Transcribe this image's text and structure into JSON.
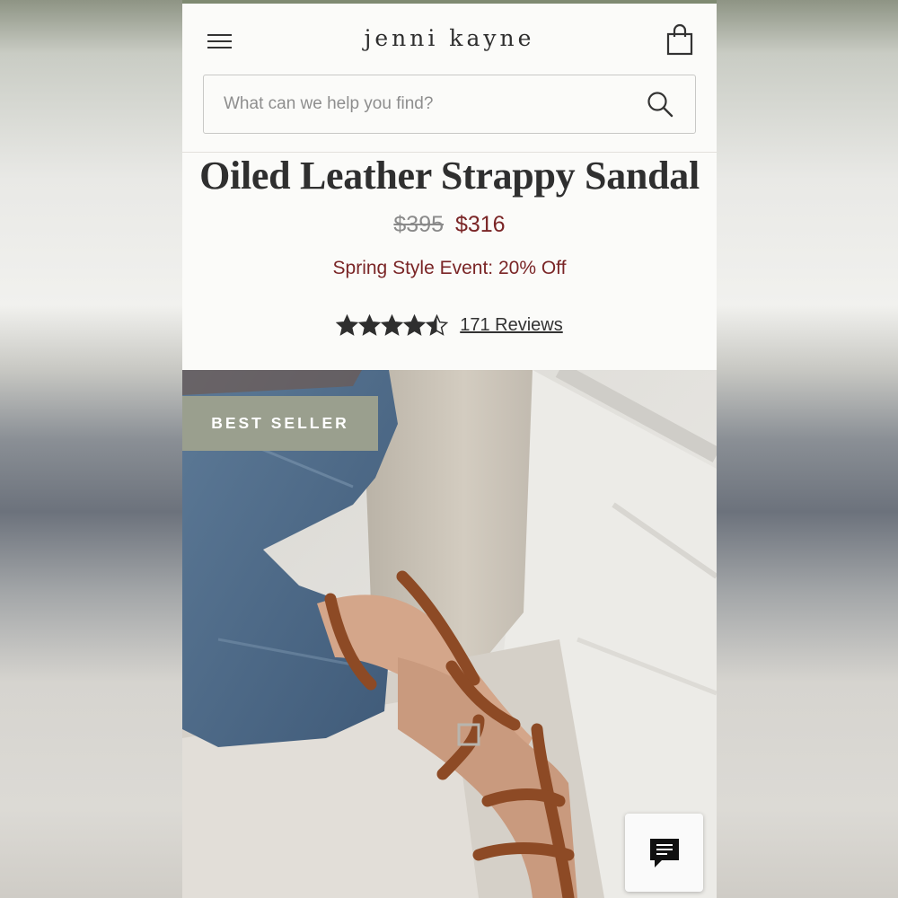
{
  "header": {
    "brand": "jenni kayne",
    "menu_icon": "hamburger-icon",
    "cart_icon": "shopping-bag-icon"
  },
  "search": {
    "placeholder": "What can we help you find?",
    "icon": "search-icon"
  },
  "product": {
    "title": "Oiled Leather Strappy Sandal",
    "price_original": "$395",
    "price_sale": "$316",
    "promo": "Spring Style Event: 20% Off",
    "rating": 4.5,
    "rating_max": 5,
    "reviews_label": "171 Reviews"
  },
  "hero": {
    "badge": "BEST SELLER"
  },
  "chat": {
    "icon": "chat-icon"
  },
  "colors": {
    "accent_strip": "#7f8a72",
    "sale_red": "#7a2526",
    "badge_bg": "#9a9f8e"
  }
}
